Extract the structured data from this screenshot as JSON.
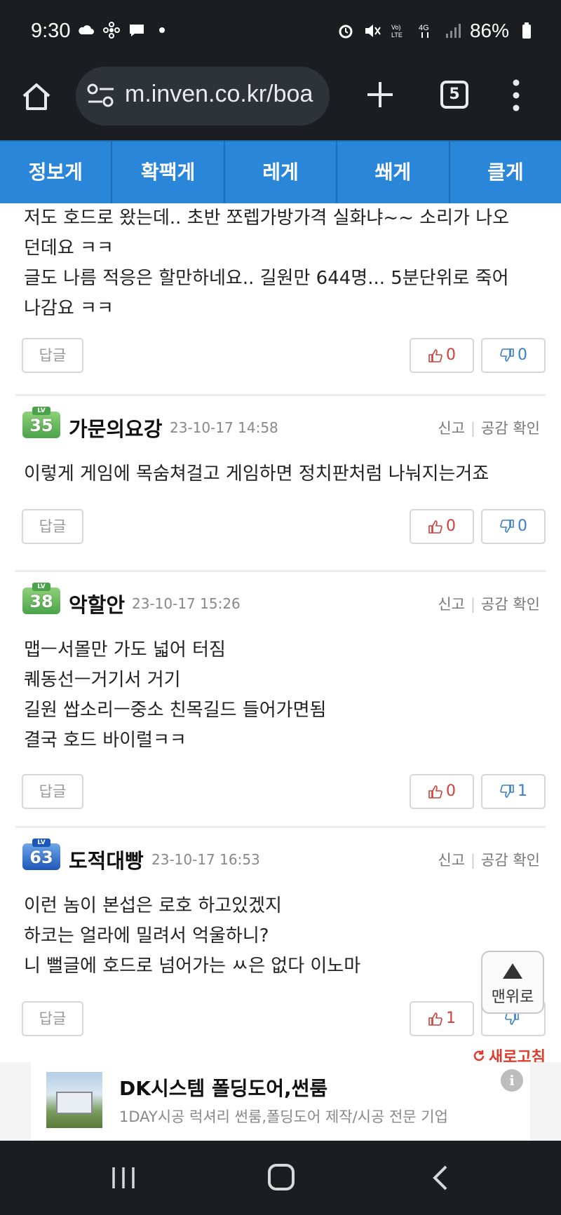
{
  "status": {
    "time": "9:30",
    "battery": "86%"
  },
  "browser": {
    "url": "m.inven.co.kr/boa",
    "tab_count": "5"
  },
  "board_tabs": [
    "정보게",
    "확팩게",
    "레게",
    "쐐게",
    "클게"
  ],
  "labels": {
    "report": "신고",
    "check_likes": "공감 확인",
    "reply": "답글",
    "scroll_top": "맨위로",
    "refresh": "새로고침"
  },
  "comments": [
    {
      "partial": true,
      "lines": [
        "저도 호드로 왔는데.. 초반 쪼렙가방가격 실화냐~~ 소리가 나오",
        "던데요 ㅋㅋ",
        "글도 나름 적응은 할만하네요.. 길원만 644명... 5분단위로 죽어",
        "나감요 ㅋㅋ"
      ],
      "up": "0",
      "down": "0"
    },
    {
      "level": "35",
      "level_tag": "LV",
      "badge_color": "green",
      "nick": "가문의요강",
      "date": "23-10-17 14:58",
      "lines": [
        "이렇게 게임에 목숨쳐걸고 게임하면 정치판처럼 나눠지는거죠"
      ],
      "up": "0",
      "down": "0"
    },
    {
      "level": "38",
      "level_tag": "LV",
      "badge_color": "green",
      "nick": "악할안",
      "date": "23-10-17 15:26",
      "lines": [
        "맵ㅡ서몰만 가도 넓어 터짐",
        "퀘동선ㅡ거기서 거기",
        "길원 쌉소리ㅡ중소 친목길드 들어가면됨",
        "결국 호드 바이럴ㅋㅋ"
      ],
      "up": "0",
      "down": "1"
    },
    {
      "level": "63",
      "level_tag": "LV",
      "badge_color": "blue",
      "nick": "도적대빵",
      "date": "23-10-17 16:53",
      "lines": [
        "이런 놈이 본섭은 로호 하고있겠지",
        "하코는 얼라에 밀려서 억울하니?",
        "니 뻘글에 호드로 넘어가는 ㅆ은 없다 이노마"
      ],
      "up": "1",
      "down": ""
    }
  ],
  "ad": {
    "title": "DK시스템 폴딩도어,썬룸",
    "subtitle": "1DAY시공 럭셔리 썬룸,폴딩도어 제작/시공 전문 기업",
    "info": "i"
  },
  "colors": {
    "tab_bar": "#2a86d9",
    "upvote": "#d0403a",
    "downvote": "#3b7fcc",
    "refresh": "#e03a2a"
  }
}
